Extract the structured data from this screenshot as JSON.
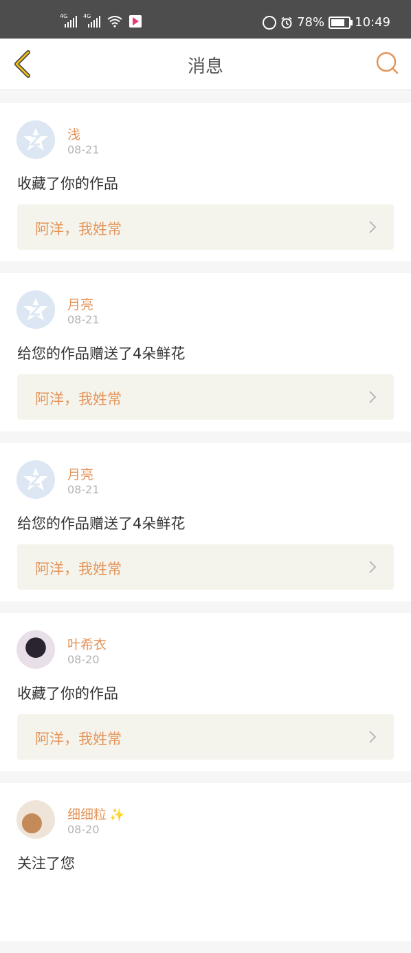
{
  "status_bar": {
    "sim1": "4G",
    "sim2": "4G",
    "battery_percent": "78%",
    "battery_level": 0.78,
    "time": "10:49"
  },
  "nav": {
    "title": "消息",
    "back_icon": "back-chevron-icon",
    "search_icon": "search-icon",
    "accent_color": "#e4945a",
    "back_color": "#f0c020"
  },
  "messages": [
    {
      "username": "浅",
      "date": "08-21",
      "action": "收藏了你的作品",
      "work_title": "阿洋，我姓常",
      "avatar": "default-avatar"
    },
    {
      "username": "月亮",
      "date": "08-21",
      "action": "给您的作品赠送了4朵鲜花",
      "work_title": "阿洋，我姓常",
      "avatar": "default-avatar"
    },
    {
      "username": "月亮",
      "date": "08-21",
      "action": "给您的作品赠送了4朵鲜花",
      "work_title": "阿洋，我姓常",
      "avatar": "default-avatar"
    },
    {
      "username": "叶希衣",
      "date": "08-20",
      "action": "收藏了你的作品",
      "work_title": "阿洋，我姓常",
      "avatar": "photo-avatar"
    },
    {
      "username": "细细粒",
      "date": "08-20",
      "action": "关注了您",
      "avatar": "photo-avatar"
    }
  ]
}
